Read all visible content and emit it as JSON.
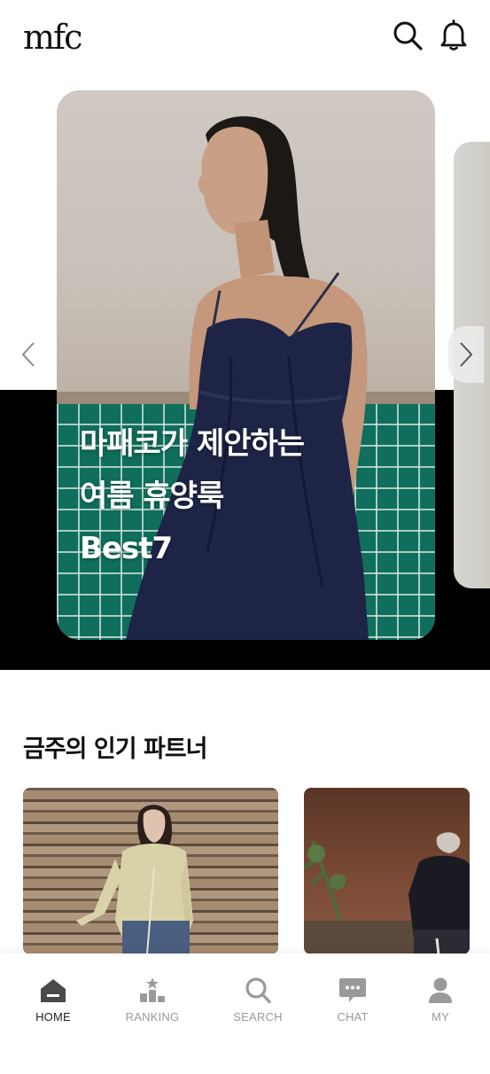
{
  "header": {
    "logo_text": "mfc",
    "search_icon": "search-icon",
    "bell_icon": "bell-icon"
  },
  "hero": {
    "title_lines": [
      "마패코가 제안하는",
      "여름 휴양룩",
      "Best7"
    ],
    "prev_icon": "chevron-left-icon",
    "next_icon": "chevron-right-icon"
  },
  "partners": {
    "title": "금주의 인기 파트너"
  },
  "bottom_nav": {
    "items": [
      {
        "label": "HOME",
        "icon": "home-icon",
        "active": true
      },
      {
        "label": "RANKING",
        "icon": "ranking-icon",
        "active": false
      },
      {
        "label": "SEARCH",
        "icon": "search-icon",
        "active": false
      },
      {
        "label": "CHAT",
        "icon": "chat-icon",
        "active": false
      },
      {
        "label": "MY",
        "icon": "user-icon",
        "active": false
      }
    ]
  },
  "colors": {
    "active": "#4a4a4a",
    "inactive": "#9a9a9a",
    "hero_band": "#000000"
  }
}
